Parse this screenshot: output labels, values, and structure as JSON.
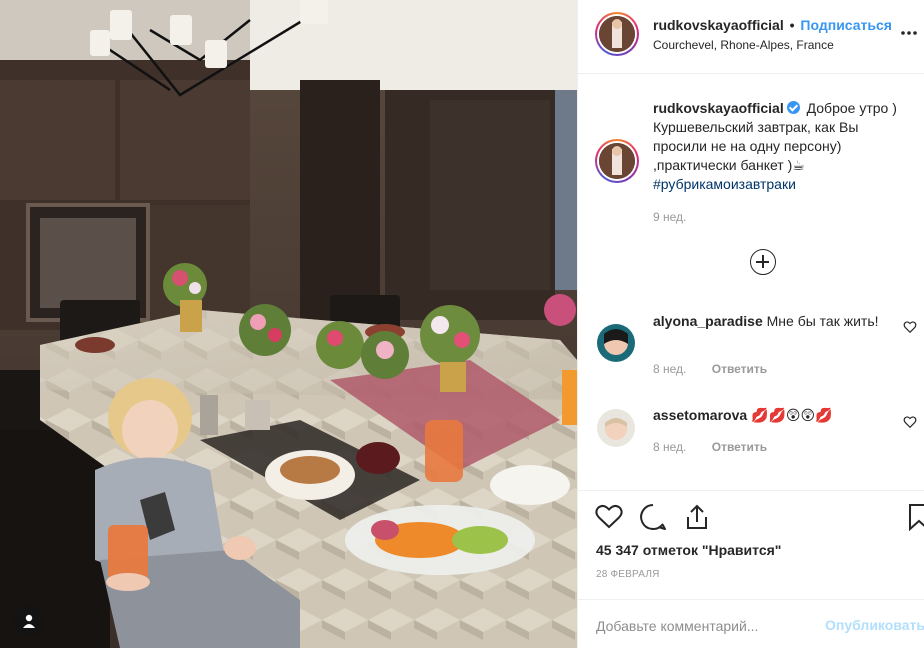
{
  "colors": {
    "accent": "#3897f0",
    "hashtag": "#003569",
    "muted": "#999999",
    "publish_disabled": "#b2dffc"
  },
  "header": {
    "username": "rudkovskayaofficial",
    "separator": "•",
    "follow_label": "Подписаться",
    "location": "Courchevel, Rhone-Alpes, France",
    "more_icon": "more-horizontal-icon"
  },
  "caption": {
    "username": "rudkovskayaofficial",
    "text": "Доброе утро ) Куршевельский завтрак, как Вы просили не на одну персону) ,практически банкет )☕",
    "hashtag": "#рубрикамоизавтраки",
    "time": "9 нед."
  },
  "comments": [
    {
      "username": "alyona_paradise",
      "text": "Мне бы так жить!",
      "time": "8 нед.",
      "reply": "Ответить"
    },
    {
      "username": "assetomarova",
      "text": "💋💋😲😲💋",
      "time": "8 нед.",
      "reply": "Ответить"
    }
  ],
  "actions": {
    "likes": "45 347 отметок \"Нравится\"",
    "date": "28 ФЕВРАЛЯ",
    "comment_placeholder": "Добавьте комментарий...",
    "publish_label": "Опубликовать"
  }
}
